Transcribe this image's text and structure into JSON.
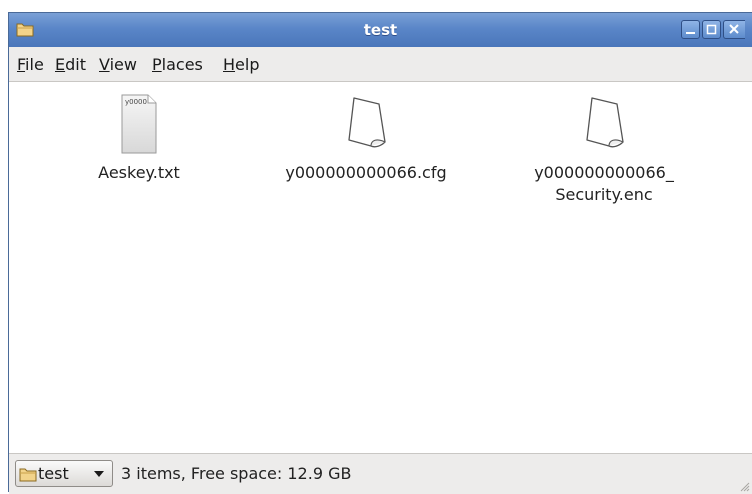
{
  "window": {
    "title": "test",
    "titlebar_color": "#5a86c8"
  },
  "menu": {
    "items": [
      {
        "label": "File",
        "mnemonic": "F",
        "rest": "ile"
      },
      {
        "label": "Edit",
        "mnemonic": "E",
        "rest": "dit"
      },
      {
        "label": "View",
        "mnemonic": "V",
        "rest": "iew"
      },
      {
        "label": "Places",
        "mnemonic": "P",
        "rest": "laces"
      },
      {
        "label": "Help",
        "mnemonic": "H",
        "rest": "elp"
      }
    ]
  },
  "files": [
    {
      "name": "Aeskey.txt",
      "icon": "text-file-icon",
      "preview_text": "y0000"
    },
    {
      "name": "y000000000066.cfg",
      "icon": "blank-document-icon"
    },
    {
      "name_line1": "y000000000066_",
      "name_line2": "Security.enc",
      "icon": "blank-document-icon"
    }
  ],
  "statusbar": {
    "path_label": "test",
    "info": "3 items, Free space: 12.9 GB"
  }
}
